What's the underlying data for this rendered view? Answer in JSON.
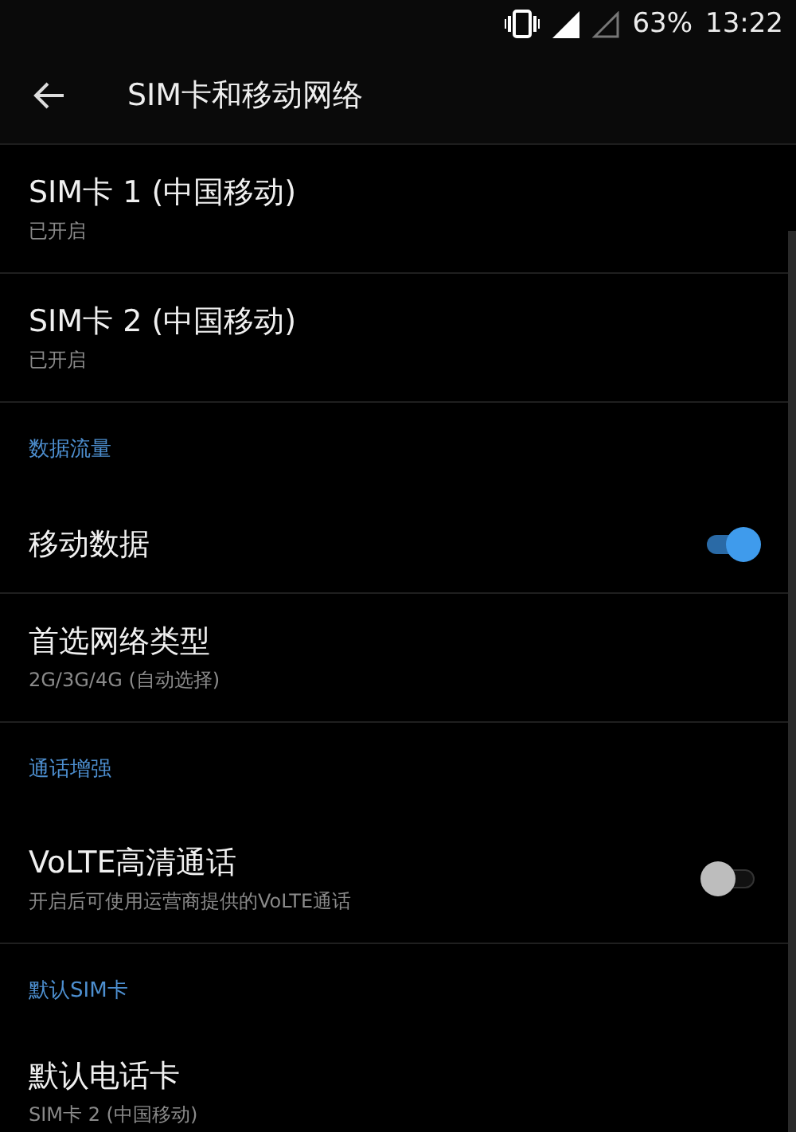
{
  "status_bar": {
    "battery": "63%",
    "time": "13:22"
  },
  "toolbar": {
    "title": "SIM卡和移动网络"
  },
  "items": [
    {
      "kind": "item",
      "title": "SIM卡 1 (中国移动)",
      "summary": "已开启"
    },
    {
      "kind": "item",
      "title": "SIM卡 2 (中国移动)",
      "summary": "已开启"
    },
    {
      "kind": "header",
      "title": "数据流量"
    },
    {
      "kind": "toggle",
      "title": "移动数据",
      "on": true
    },
    {
      "kind": "item",
      "title": "首选网络类型",
      "summary": "2G/3G/4G (自动选择)"
    },
    {
      "kind": "header",
      "title": "通话增强"
    },
    {
      "kind": "toggle",
      "title": "VoLTE高清通话",
      "summary": "开启后可使用运营商提供的VoLTE通话",
      "on": false
    },
    {
      "kind": "header",
      "title": "默认SIM卡"
    },
    {
      "kind": "item",
      "title": "默认电话卡",
      "summary": "SIM卡 2 (中国移动)"
    }
  ]
}
